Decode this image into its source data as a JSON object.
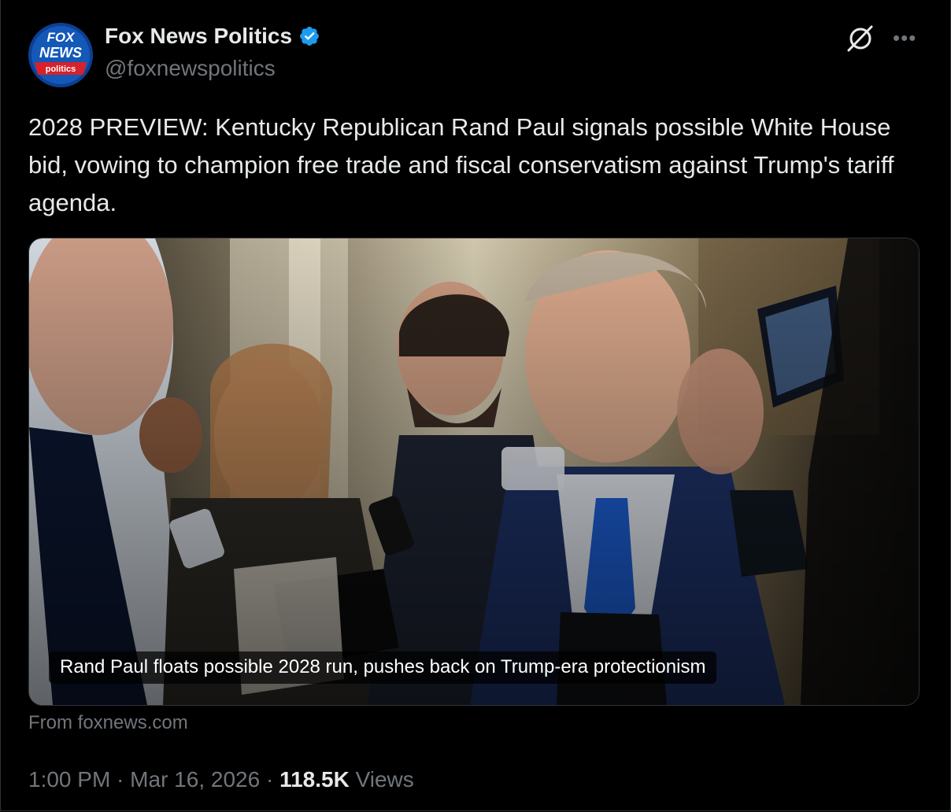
{
  "account": {
    "name": "Fox News Politics",
    "handle": "@foxnewspolitics",
    "verified": true,
    "logo_text_top": "FOX",
    "logo_text_mid": "NEWS",
    "logo_text_bottom": "politics",
    "verified_color": "#1d9bf0"
  },
  "tweet": {
    "text": "2028 PREVIEW: Kentucky Republican Rand Paul signals possible White House bid, vowing to champion free trade and fiscal conservatism against Trump's tariff agenda."
  },
  "card": {
    "caption": "Rand Paul floats possible 2028 run, pushes back on Trump-era protectionism",
    "source": "From foxnews.com"
  },
  "meta": {
    "time": "1:00 PM",
    "separator": " · ",
    "date": "Mar 16, 2026",
    "views_count": "118.5K",
    "views_label": "Views"
  },
  "icons": {
    "grok": "grok-icon",
    "more": "more-icon",
    "verified": "verified-badge-icon"
  },
  "colors": {
    "background": "#000000",
    "text_primary": "#e7e9ea",
    "text_secondary": "#71767b",
    "border": "#2f3336"
  }
}
